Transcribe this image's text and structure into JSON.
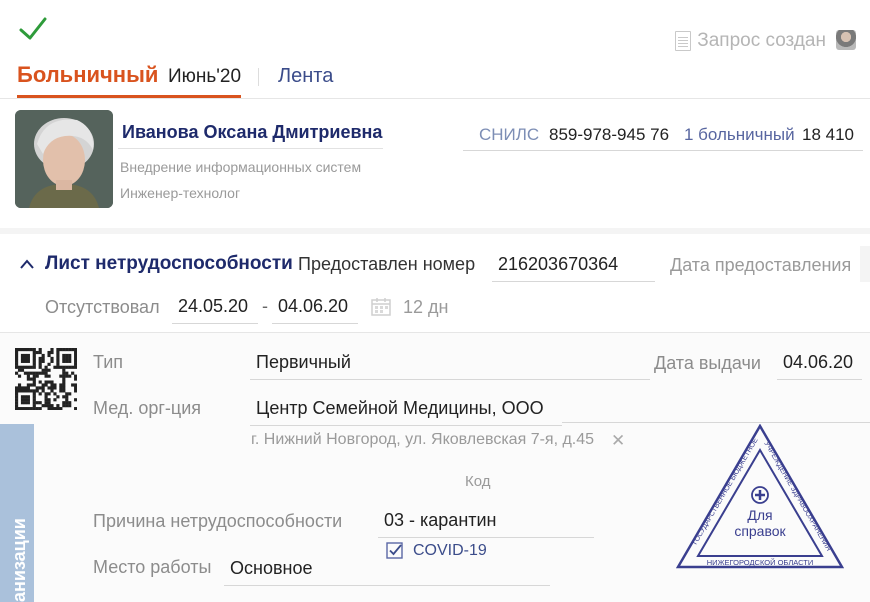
{
  "header": {
    "status": "Запрос создан",
    "tabs": {
      "main": "Больничный",
      "month": "Июнь'20",
      "feed": "Лента"
    }
  },
  "employee": {
    "name": "Иванова Оксана Дмитриевна",
    "department": "Внедрение  информационных систем",
    "position": "Инженер-технолог",
    "snils_label": "СНИЛС",
    "snils": "859-978-945 76",
    "sick_label": "1 больничный",
    "sick_amount": "18 410"
  },
  "sheet": {
    "title": "Лист нетрудоспособности",
    "provided_label": "Предоставлен номер",
    "number": "216203670364",
    "date_provided_label": "Дата предоставления",
    "absent_label": "Отсутствовал",
    "date_from": "24.05.20",
    "dash": "-",
    "date_to": "04.06.20",
    "days": "12 дн"
  },
  "details": {
    "type_label": "Тип",
    "type": "Первичный",
    "issue_label": "Дата выдачи",
    "issue_date": "04.06.20",
    "org_label": "Мед. орг-ция",
    "org": "Центр Семейной Медицины, ООО",
    "address": "г. Нижний Новгород, ул. Яковлевская 7-я, д.45",
    "code_label": "Код",
    "reason_label": "Причина нетрудоспособности",
    "reason": "03 - карантин",
    "covid_checked": true,
    "covid_label": "COVID-19",
    "work_label": "Место работы",
    "work": "Основное"
  },
  "side_tab": "анизации",
  "stamp": {
    "center_text": "Для справок",
    "left_text": "ГОСУДАРСТВЕННОЕ БЮДЖЕТНОЕ",
    "right_text": "УЧРЕЖДЕНИЕ ЗДРАВООХРАНЕНИЯ",
    "bottom_text": "НИЖЕГОРОДСКОЙ ОБЛАСТИ"
  },
  "colors": {
    "accent": "#d9531e",
    "title_blue": "#1e2a6b",
    "link_blue": "#3b4c8a",
    "check_green": "#2e9b3a",
    "stamp": "#3a3f8f"
  }
}
